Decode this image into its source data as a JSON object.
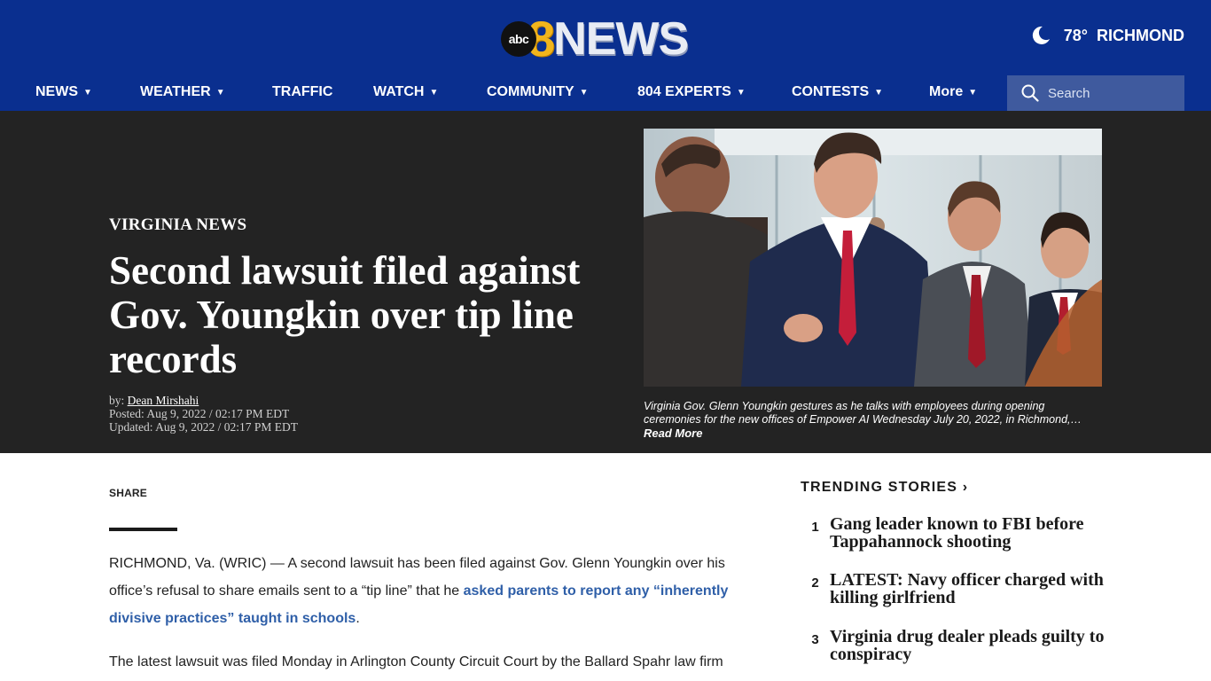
{
  "header": {
    "logo": {
      "abc": "abc",
      "eight": "8",
      "news": "NEWS"
    },
    "weather": {
      "temp": "78°",
      "city": "RICHMOND"
    }
  },
  "nav": {
    "items": [
      {
        "label": "NEWS",
        "caret": "▼"
      },
      {
        "label": "WEATHER",
        "caret": "▼"
      },
      {
        "label": "TRAFFIC",
        "caret": ""
      },
      {
        "label": "WATCH",
        "caret": "▼"
      },
      {
        "label": "COMMUNITY",
        "caret": "▼"
      },
      {
        "label": "804 EXPERTS",
        "caret": "▼"
      },
      {
        "label": "CONTESTS",
        "caret": "▼"
      },
      {
        "label": "More",
        "caret": "▼"
      }
    ],
    "search_placeholder": "Search"
  },
  "hero": {
    "kicker": "VIRGINIA NEWS",
    "headline": "Second lawsuit filed against Gov. Youngkin over tip line records",
    "byline_prefix": "by:",
    "author": "Dean Mirshahi",
    "posted": "Posted: Aug 9, 2022 / 02:17 PM EDT",
    "updated": "Updated: Aug 9, 2022 / 02:17 PM EDT",
    "caption": "Virginia Gov. Glenn Youngkin gestures as he talks with employees during opening ceremonies for the new offices of Empower AI Wednesday July 20, 2022, in Richmond,…",
    "read_more": "Read More"
  },
  "article": {
    "share_label": "SHARE",
    "p1_start": "RICHMOND, Va. (WRIC) — A second lawsuit has been filed against Gov. Glenn Youngkin over his office’s refusal to share emails sent to a “tip line” that he ",
    "p1_link": "asked parents to report any “inherently divisive practices” taught in schools",
    "p1_end": ".",
    "p2": "The latest lawsuit was filed Monday in Arlington County Circuit Court by the Ballard Spahr law firm"
  },
  "trending": {
    "title": "TRENDING STORIES ›",
    "items": [
      {
        "num": "1",
        "text": "Gang leader known to FBI before Tappahannock shooting"
      },
      {
        "num": "2",
        "text": "LATEST: Navy officer charged with killing girlfriend"
      },
      {
        "num": "3",
        "text": "Virginia drug dealer pleads guilty to conspiracy"
      }
    ]
  },
  "colors": {
    "header_bg": "#0a2f8f",
    "search_bg": "#3f5a9e",
    "hero_bg": "#232323",
    "link": "#2f5fa8"
  }
}
